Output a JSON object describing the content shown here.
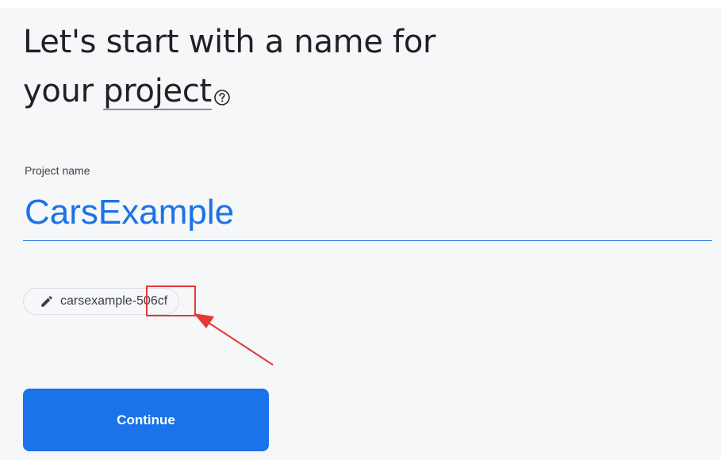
{
  "heading": {
    "line1": "Let's start with a name for",
    "line2_prefix": "your ",
    "line2_term": "project"
  },
  "form": {
    "label": "Project name",
    "value": "CarsExample"
  },
  "project_id": {
    "text": "carsexample-506cf"
  },
  "actions": {
    "continue_label": "Continue"
  },
  "icons": {
    "help": "help-circle-icon",
    "edit": "pencil-icon"
  },
  "colors": {
    "accent": "#1a73e8",
    "annotation": "#e53935",
    "background": "#f6f7f9",
    "text": "#202124"
  }
}
